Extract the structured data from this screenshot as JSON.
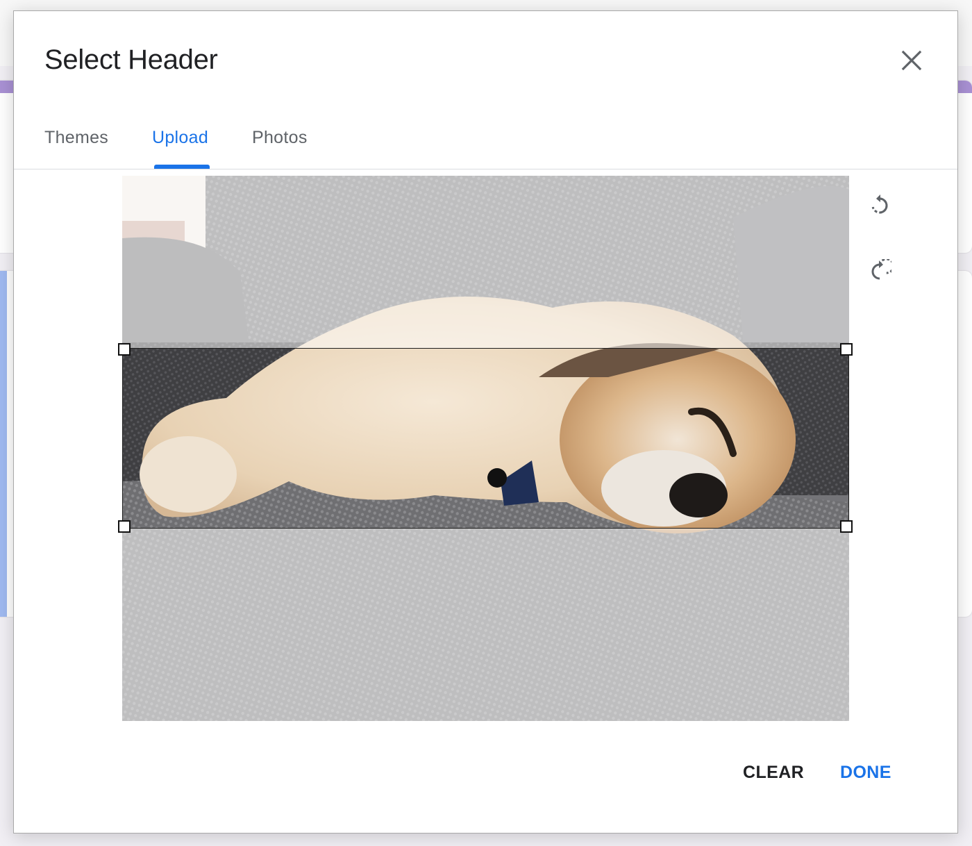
{
  "dialog": {
    "title": "Select Header",
    "close_icon": "close-icon",
    "tabs": [
      {
        "label": "Themes",
        "active": false
      },
      {
        "label": "Upload",
        "active": true
      },
      {
        "label": "Photos",
        "active": false
      }
    ],
    "tools": [
      {
        "icon": "rotate-left-icon",
        "label": "Rotate left"
      },
      {
        "icon": "rotate-right-icon",
        "label": "Rotate right"
      }
    ],
    "image": {
      "description": "Sleeping dog on a gray couch",
      "crop_handles": [
        "top-left",
        "top-right",
        "bottom-left",
        "bottom-right"
      ]
    },
    "actions": {
      "clear_label": "CLEAR",
      "done_label": "DONE"
    }
  },
  "colors": {
    "accent": "#1a73e8",
    "text_primary": "#202124",
    "text_secondary": "#5f6368",
    "background_theme_purple": "#a991d4",
    "background_theme_blue": "#9fb9f0"
  }
}
